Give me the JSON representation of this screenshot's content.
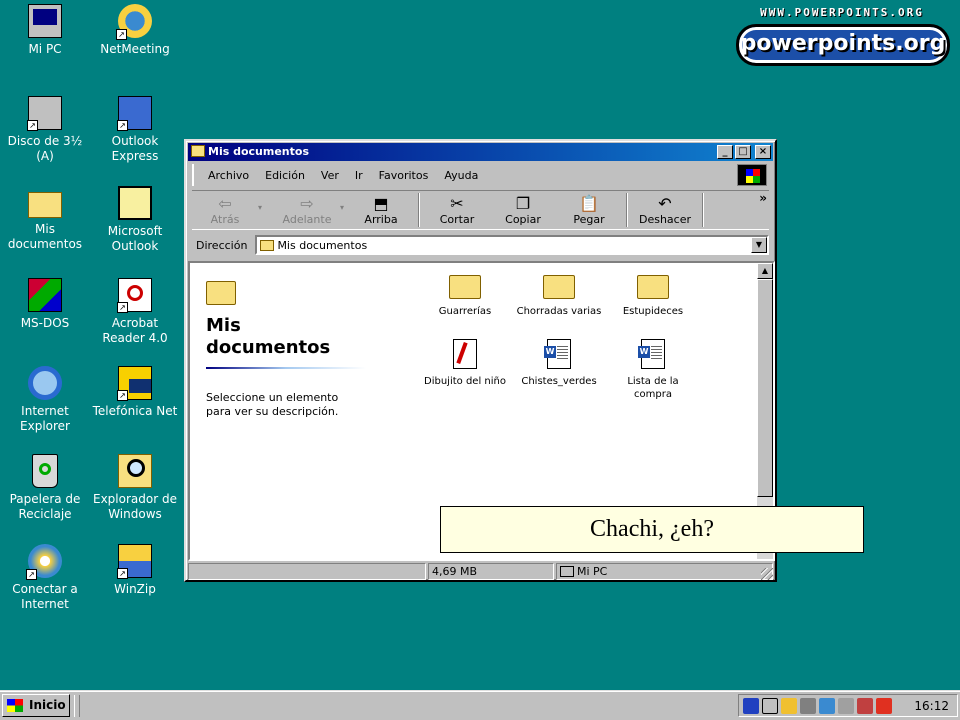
{
  "desktop": {
    "icons": [
      {
        "label": "Mi PC",
        "icon": "computer-icon"
      },
      {
        "label": "NetMeeting",
        "icon": "netmeeting-icon"
      },
      {
        "label": "Disco de 3½ (A)",
        "icon": "floppy-drive-icon"
      },
      {
        "label": "Outlook Express",
        "icon": "outlook-express-icon"
      },
      {
        "label": "Mis documentos",
        "icon": "folder-icon"
      },
      {
        "label": "Microsoft Outlook",
        "icon": "outlook-icon"
      },
      {
        "label": "MS-DOS",
        "icon": "ms-dos-icon"
      },
      {
        "label": "Acrobat Reader 4.0",
        "icon": "acrobat-icon"
      },
      {
        "label": "Internet Explorer",
        "icon": "ie-icon"
      },
      {
        "label": "Telefónica Net",
        "icon": "telefonica-icon"
      },
      {
        "label": "Papelera de Reciclaje",
        "icon": "recycle-bin-icon"
      },
      {
        "label": "Explorador de Windows",
        "icon": "explorer-icon"
      },
      {
        "label": "Conectar a Internet",
        "icon": "connect-icon"
      },
      {
        "label": "WinZip",
        "icon": "winzip-icon"
      }
    ]
  },
  "logo": {
    "url": "WWW.POWERPOINTS.ORG",
    "name": "powerpoints.org"
  },
  "window": {
    "title": "Mis documentos",
    "menu": [
      "Archivo",
      "Edición",
      "Ver",
      "Ir",
      "Favoritos",
      "Ayuda"
    ],
    "toolbar": {
      "back": "Atrás",
      "forward": "Adelante",
      "up": "Arriba",
      "cut": "Cortar",
      "copy": "Copiar",
      "paste": "Pegar",
      "undo": "Deshacer",
      "more": "»"
    },
    "address": {
      "label": "Dirección",
      "value": "Mis documentos"
    },
    "left_pane": {
      "title": "Mis documentos",
      "description": "Seleccione un elemento para ver su descripción."
    },
    "files": [
      {
        "name": "Guarrerías",
        "type": "folder"
      },
      {
        "name": "Chorradas varias",
        "type": "folder"
      },
      {
        "name": "Estupideces",
        "type": "folder"
      },
      {
        "name": "Dibujito del niño",
        "type": "paint"
      },
      {
        "name": "Chistes_verdes",
        "type": "word"
      },
      {
        "name": "Lista de la compra",
        "type": "word"
      }
    ],
    "status": {
      "size": "4,69 MB",
      "location": "Mi PC"
    }
  },
  "tooltip": {
    "text": "Chachi, ¿eh?"
  },
  "taskbar": {
    "start_label": "Inicio",
    "clock": "16:12"
  }
}
